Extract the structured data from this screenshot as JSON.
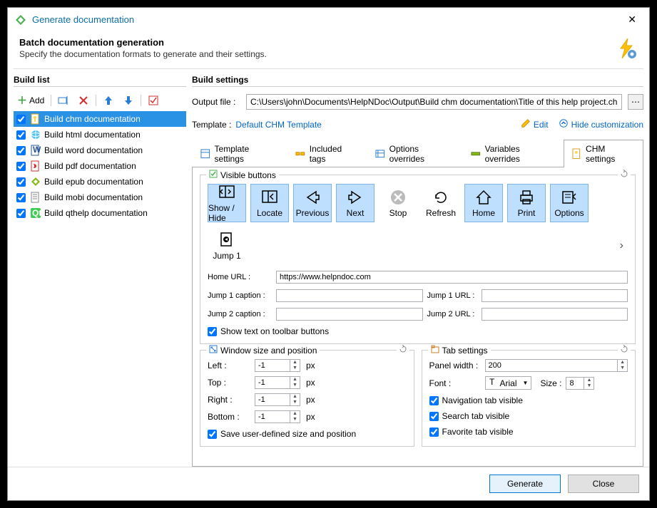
{
  "window": {
    "title": "Generate documentation"
  },
  "header": {
    "title": "Batch documentation generation",
    "subtitle": "Specify the documentation formats to generate and their settings."
  },
  "left": {
    "panel_title": "Build list",
    "add_label": "Add",
    "items": [
      {
        "label": "Build chm documentation",
        "checked": true,
        "selected": true,
        "icon": "chm"
      },
      {
        "label": "Build html documentation",
        "checked": true,
        "selected": false,
        "icon": "html"
      },
      {
        "label": "Build word documentation",
        "checked": true,
        "selected": false,
        "icon": "word"
      },
      {
        "label": "Build pdf documentation",
        "checked": true,
        "selected": false,
        "icon": "pdf"
      },
      {
        "label": "Build epub documentation",
        "checked": true,
        "selected": false,
        "icon": "epub"
      },
      {
        "label": "Build mobi documentation",
        "checked": true,
        "selected": false,
        "icon": "mobi"
      },
      {
        "label": "Build qthelp documentation",
        "checked": true,
        "selected": false,
        "icon": "qt"
      }
    ]
  },
  "right": {
    "panel_title": "Build settings",
    "output_label": "Output file :",
    "output_value": "C:\\Users\\john\\Documents\\HelpNDoc\\Output\\Build chm documentation\\Title of this help project.chm",
    "template_label": "Template :",
    "template_value": "Default CHM Template",
    "edit_label": "Edit",
    "hide_label": "Hide customization",
    "tabs": [
      {
        "label": "Template settings"
      },
      {
        "label": "Included tags"
      },
      {
        "label": "Options overrides"
      },
      {
        "label": "Variables overrides"
      },
      {
        "label": "CHM settings"
      }
    ],
    "active_tab": 4,
    "visible_buttons": {
      "group_label": "Visible buttons",
      "buttons": [
        {
          "label": "Show / Hide",
          "sel": true
        },
        {
          "label": "Locate",
          "sel": true
        },
        {
          "label": "Previous",
          "sel": true
        },
        {
          "label": "Next",
          "sel": true
        },
        {
          "label": "Stop",
          "sel": false
        },
        {
          "label": "Refresh",
          "sel": false
        },
        {
          "label": "Home",
          "sel": true
        },
        {
          "label": "Print",
          "sel": true
        },
        {
          "label": "Options",
          "sel": true
        },
        {
          "label": "Jump 1",
          "sel": false
        }
      ],
      "home_url_label": "Home URL :",
      "home_url_value": "https://www.helpndoc.com",
      "jump1_caption_label": "Jump 1 caption :",
      "jump1_caption_value": "",
      "jump1_url_label": "Jump 1 URL :",
      "jump1_url_value": "",
      "jump2_caption_label": "Jump 2 caption :",
      "jump2_caption_value": "",
      "jump2_url_label": "Jump 2 URL :",
      "jump2_url_value": "",
      "show_text_label": "Show text on toolbar buttons",
      "show_text_checked": true
    },
    "window_pos": {
      "group_label": "Window size and position",
      "left_label": "Left :",
      "left_value": "-1",
      "top_label": "Top :",
      "top_value": "-1",
      "right_label": "Right :",
      "right_value": "-1",
      "bottom_label": "Bottom :",
      "bottom_value": "-1",
      "px": "px",
      "save_label": "Save user-defined size and position",
      "save_checked": true
    },
    "tab_settings": {
      "group_label": "Tab settings",
      "panel_width_label": "Panel width :",
      "panel_width_value": "200",
      "font_label": "Font :",
      "font_value": "Arial",
      "size_label": "Size :",
      "size_value": "8",
      "nav_label": "Navigation tab visible",
      "nav_checked": true,
      "search_label": "Search tab visible",
      "search_checked": true,
      "fav_label": "Favorite tab visible",
      "fav_checked": true
    }
  },
  "footer": {
    "generate": "Generate",
    "close": "Close"
  }
}
